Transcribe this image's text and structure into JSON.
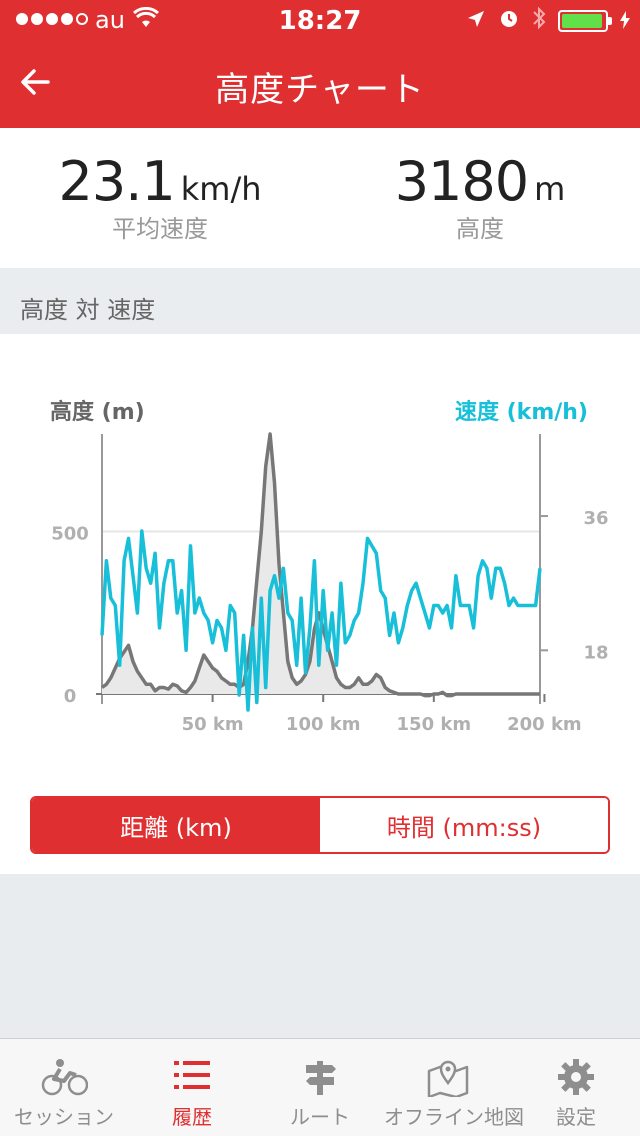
{
  "status": {
    "carrier": "au",
    "time": "18:27"
  },
  "nav": {
    "title": "高度チャート"
  },
  "stats": {
    "speed": {
      "value": "23.1",
      "unit": "km/h",
      "label": "平均速度"
    },
    "altitude": {
      "value": "3180",
      "unit": "m",
      "label": "高度"
    }
  },
  "section": {
    "title": "高度 対 速度"
  },
  "chart": {
    "left_title": "高度 (m)",
    "right_title": "速度 (km/h)"
  },
  "segmented": {
    "distance": "距離 (km)",
    "time": "時間 (mm:ss)"
  },
  "tabs": [
    {
      "label": "セッション",
      "icon": "cyclist-icon"
    },
    {
      "label": "履歴",
      "icon": "list-icon"
    },
    {
      "label": "ルート",
      "icon": "signpost-icon"
    },
    {
      "label": "オフライン地図",
      "icon": "map-pin-icon"
    },
    {
      "label": "設定",
      "icon": "gear-icon"
    }
  ],
  "colors": {
    "accent": "#e02f31",
    "speed": "#17bfd9",
    "altitude": "#777777"
  },
  "chart_data": {
    "type": "line",
    "x_ticks": [
      "50 km",
      "100 km",
      "150 km",
      "200 km"
    ],
    "x_tick_values": [
      50,
      100,
      150,
      200
    ],
    "xlim": [
      0,
      198
    ],
    "left_ticks": [
      "0",
      "500"
    ],
    "left_tick_values": [
      0,
      500
    ],
    "ylim_left": [
      0,
      800
    ],
    "right_ticks": [
      "18",
      "36"
    ],
    "right_tick_values": [
      18,
      36
    ],
    "ylim_right": [
      10.8,
      47
    ],
    "series": [
      {
        "axis": "left",
        "color": "#777777",
        "fill": true,
        "x": [
          0,
          2,
          4,
          6,
          8,
          10,
          12,
          14,
          16,
          18,
          20,
          22,
          24,
          26,
          28,
          30,
          32,
          34,
          36,
          38,
          40,
          42,
          44,
          46,
          48,
          50,
          52,
          54,
          56,
          58,
          60,
          62,
          64,
          66,
          68,
          70,
          72,
          74,
          76,
          78,
          80,
          82,
          84,
          86,
          88,
          90,
          92,
          94,
          96,
          98,
          100,
          102,
          104,
          106,
          108,
          110,
          112,
          114,
          116,
          118,
          120,
          122,
          124,
          126,
          128,
          130,
          132,
          134,
          136,
          138,
          140,
          142,
          144,
          146,
          148,
          150,
          152,
          154,
          156,
          158,
          160,
          162,
          164,
          166,
          168,
          170,
          172,
          174,
          176,
          178,
          180,
          182,
          184,
          186,
          188,
          190,
          192,
          194,
          196,
          198
        ],
        "y": [
          20,
          30,
          50,
          80,
          110,
          130,
          150,
          100,
          70,
          50,
          30,
          30,
          10,
          20,
          20,
          15,
          30,
          25,
          10,
          5,
          20,
          40,
          80,
          120,
          100,
          80,
          70,
          50,
          40,
          30,
          30,
          20,
          30,
          100,
          200,
          350,
          500,
          700,
          800,
          650,
          400,
          250,
          100,
          50,
          30,
          40,
          60,
          100,
          200,
          250,
          200,
          150,
          100,
          50,
          30,
          20,
          20,
          30,
          50,
          30,
          30,
          40,
          60,
          50,
          20,
          10,
          5,
          0,
          0,
          0,
          0,
          0,
          0,
          -5,
          -5,
          0,
          0,
          5,
          -5,
          -5,
          0,
          0,
          0,
          0,
          0,
          0,
          0,
          0,
          0,
          0,
          0,
          0,
          0,
          0,
          0,
          0,
          0,
          0,
          0,
          0
        ]
      },
      {
        "axis": "right",
        "color": "#17bfd9",
        "x": [
          0,
          2,
          4,
          6,
          8,
          10,
          12,
          14,
          16,
          18,
          20,
          22,
          24,
          26,
          28,
          30,
          32,
          34,
          36,
          38,
          40,
          42,
          44,
          46,
          48,
          50,
          52,
          54,
          56,
          58,
          60,
          62,
          64,
          66,
          68,
          70,
          72,
          74,
          76,
          78,
          80,
          82,
          84,
          86,
          88,
          90,
          92,
          94,
          96,
          98,
          100,
          102,
          104,
          106,
          108,
          110,
          112,
          114,
          116,
          118,
          120,
          122,
          124,
          126,
          128,
          130,
          132,
          134,
          136,
          138,
          140,
          142,
          144,
          146,
          148,
          150,
          152,
          154,
          156,
          158,
          160,
          162,
          164,
          166,
          168,
          170,
          172,
          174,
          176,
          178,
          180,
          182,
          184,
          186,
          188,
          190,
          192,
          194,
          196,
          198
        ],
        "y": [
          20,
          30,
          25,
          24,
          16,
          30,
          33,
          28,
          23,
          34,
          29,
          27,
          31,
          21,
          27,
          30,
          30,
          23,
          26,
          18,
          32,
          23,
          25,
          23,
          22,
          19,
          22,
          21,
          18,
          24,
          23,
          12,
          20,
          10,
          21,
          11,
          25,
          13,
          26,
          28,
          25,
          29,
          23,
          22,
          16,
          25,
          15,
          21,
          30,
          16,
          26,
          18,
          23,
          16,
          27,
          19,
          20,
          22,
          23,
          27,
          33,
          32,
          31,
          26,
          25,
          20,
          23,
          19,
          21,
          24,
          26,
          27,
          25,
          23,
          21,
          24,
          24,
          23,
          24,
          21,
          28,
          24,
          24,
          24,
          21,
          28,
          30,
          29,
          25,
          29,
          29,
          27,
          24,
          25,
          24,
          24,
          24,
          24,
          24,
          29
        ]
      }
    ]
  }
}
